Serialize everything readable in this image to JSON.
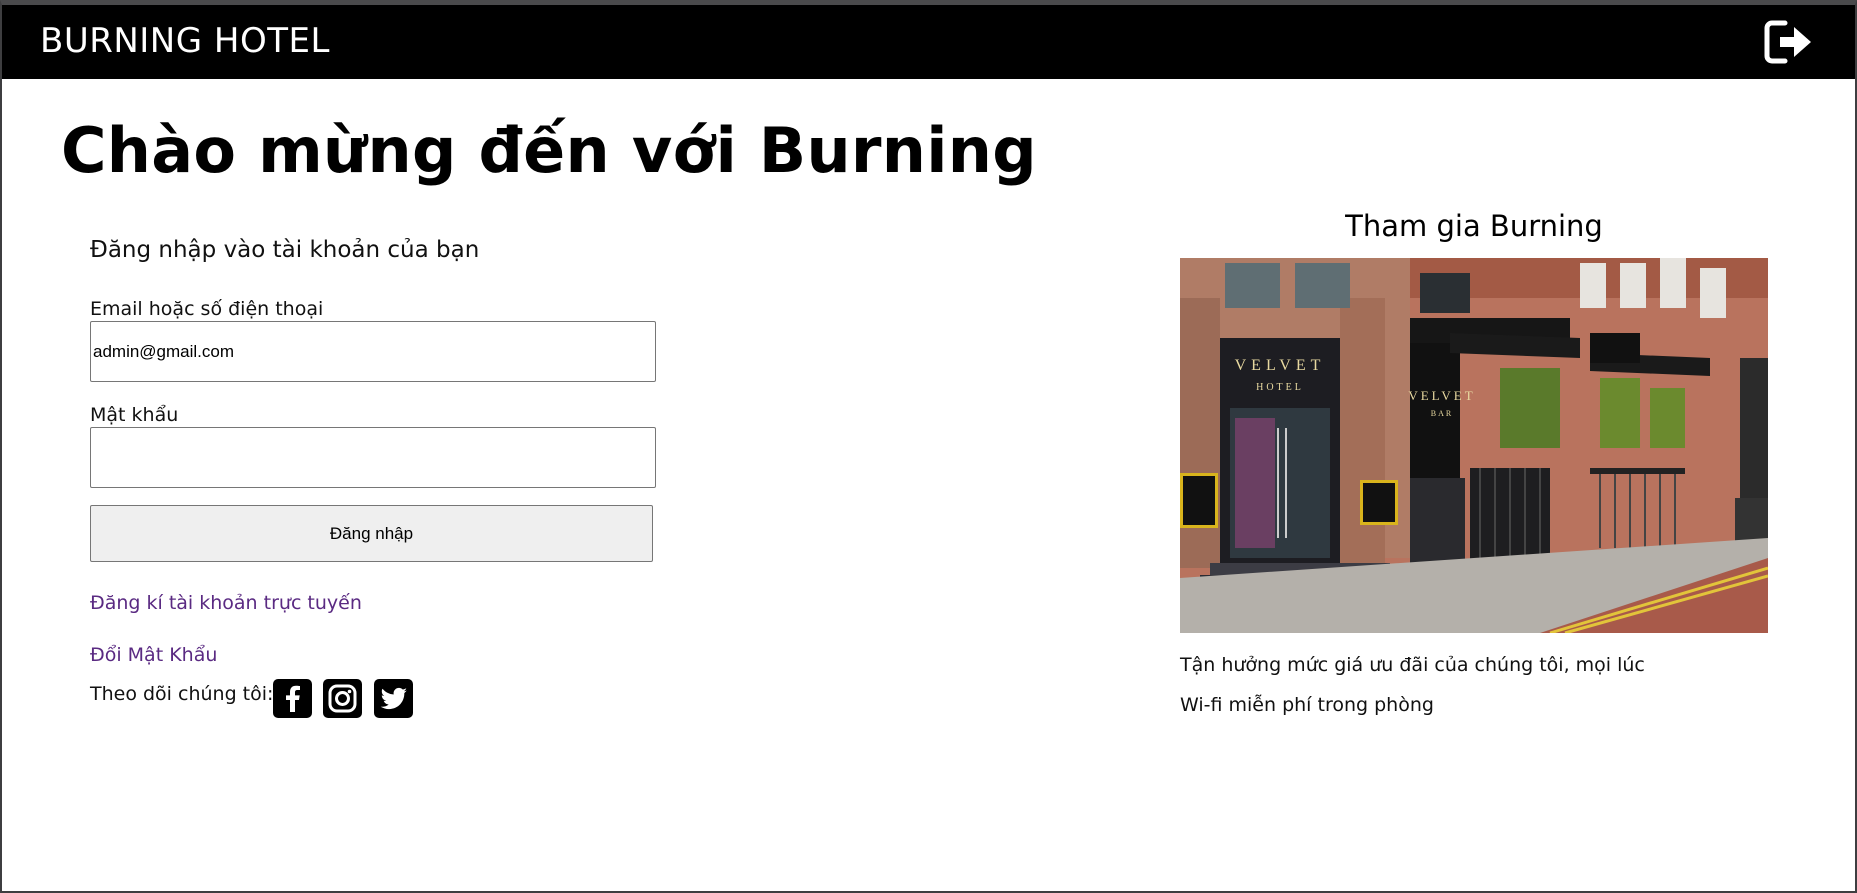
{
  "header": {
    "brand": "BURNING HOTEL",
    "logout_icon": "sign-out-icon"
  },
  "main": {
    "title": "Chào mừng đến với Burning"
  },
  "login": {
    "heading": "Đăng nhập vào tài khoản của bạn",
    "email_label": "Email hoặc số điện thoại",
    "email_value": "admin@gmail.com",
    "password_label": "Mật khẩu",
    "password_value": "",
    "submit_label": "Đăng nhập",
    "register_link": "Đăng kí tài khoản trực tuyến",
    "change_password_link": "Đổi Mật Khẩu",
    "follow_label": "Theo dõi chúng tôi:",
    "social_icons": [
      "facebook-icon",
      "instagram-icon",
      "twitter-icon"
    ]
  },
  "promo": {
    "title": "Tham gia Burning",
    "features": [
      "Tận hưởng mức giá ưu đãi của chúng tôi, mọi lúc",
      "Wi-fi miễn phí trong phòng"
    ]
  },
  "photo_text": {
    "hotel_sign_1": "VELVET",
    "hotel_sign_2": "HOTEL",
    "bar_sign_1": "VELVET",
    "bar_sign_2": "BAR"
  },
  "colors": {
    "header_bg": "#000000",
    "link": "#5a2a82",
    "button_bg": "#efefef"
  }
}
